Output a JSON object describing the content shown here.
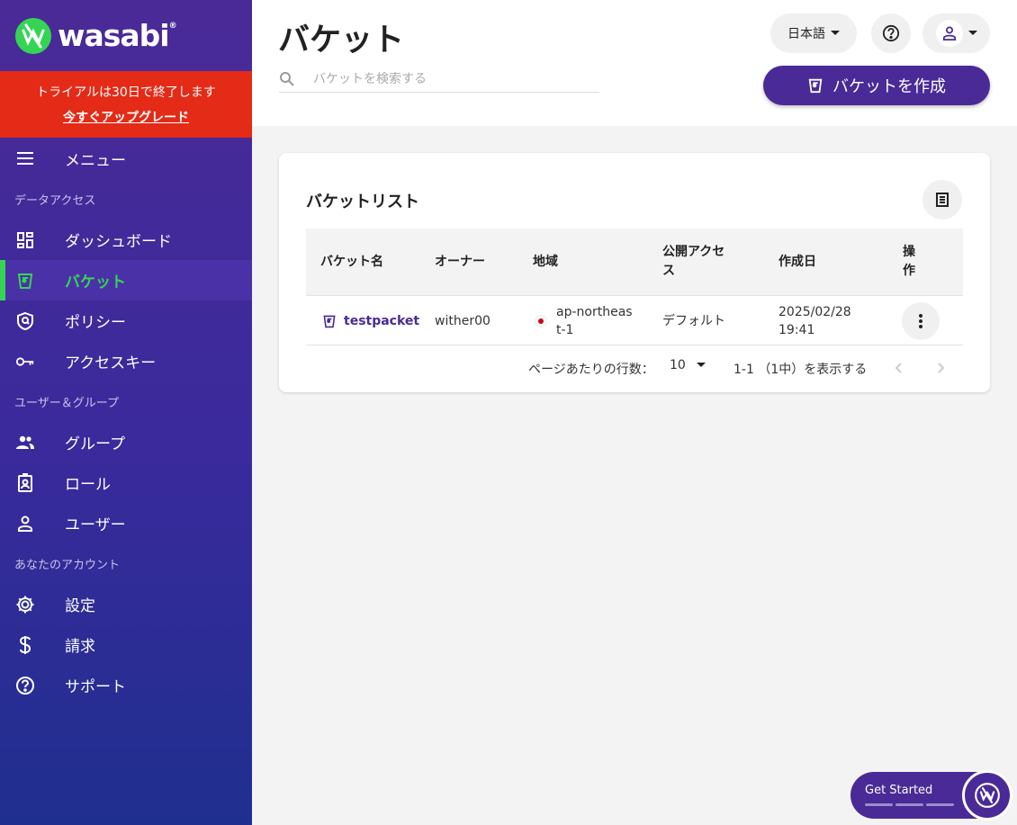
{
  "brand": {
    "name": "wasabi",
    "reg_mark": "®"
  },
  "trial": {
    "message": "トライアルは30日で終了します",
    "upgrade_link": "今すぐアップグレード"
  },
  "sidebar": {
    "menu_label": "メニュー",
    "sections": [
      {
        "title": "データアクセス"
      },
      {
        "title": "ユーザー＆グループ"
      },
      {
        "title": "あなたのアカウント"
      }
    ],
    "items": [
      {
        "label": "ダッシュボード",
        "icon": "dashboard-icon"
      },
      {
        "label": "バケット",
        "icon": "bucket-icon",
        "active": true
      },
      {
        "label": "ポリシー",
        "icon": "policy-shield-icon"
      },
      {
        "label": "アクセスキー",
        "icon": "key-icon"
      },
      {
        "label": "グループ",
        "icon": "group-icon"
      },
      {
        "label": "ロール",
        "icon": "role-badge-icon"
      },
      {
        "label": "ユーザー",
        "icon": "user-icon"
      },
      {
        "label": "設定",
        "icon": "gear-icon"
      },
      {
        "label": "請求",
        "icon": "dollar-icon"
      },
      {
        "label": "サポート",
        "icon": "help-circle-icon"
      }
    ]
  },
  "header": {
    "title": "バケット",
    "search_placeholder": "バケットを検索する",
    "language": "日本語",
    "create_button": "バケットを作成"
  },
  "bucket_list": {
    "title": "バケットリスト",
    "columns": [
      "バケット名",
      "オーナー",
      "地域",
      "公開アクセス",
      "作成日",
      "操作"
    ],
    "rows": [
      {
        "name": "testpacket",
        "owner": "wither00",
        "region": "ap-northeast-1",
        "public_access": "デフォルト",
        "created_date": "2025/02/28",
        "created_time": "19:41"
      }
    ],
    "pagination": {
      "rows_per_page_label": "ページあたりの行数：",
      "rows_per_page": "10",
      "range_text": "1-1 （1中）を表示する"
    }
  },
  "get_started": {
    "label": "Get Started"
  },
  "colors": {
    "brand_purple": "#4a2a97",
    "accent_green": "#35d455",
    "trial_red": "#e32b17"
  }
}
